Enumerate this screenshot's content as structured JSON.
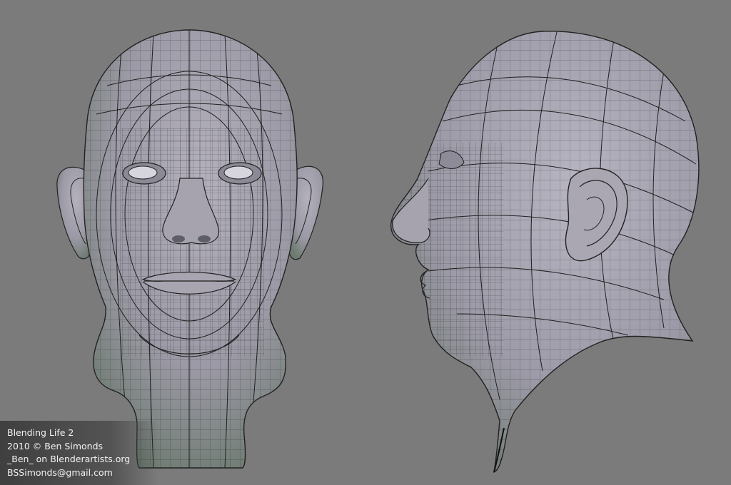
{
  "scene": {
    "background_color": "#7b7b7b",
    "mesh_fill_color": "#a9a6b1",
    "mesh_shade_color": "#6f7a6e",
    "wire_color": "#1e1e1e"
  },
  "credits": {
    "title": "Blending Life 2",
    "copyright": "2010 © Ben Simonds",
    "handle": "_Ben_ on Blenderartists.org",
    "email": "BSSimonds@gmail.com"
  }
}
